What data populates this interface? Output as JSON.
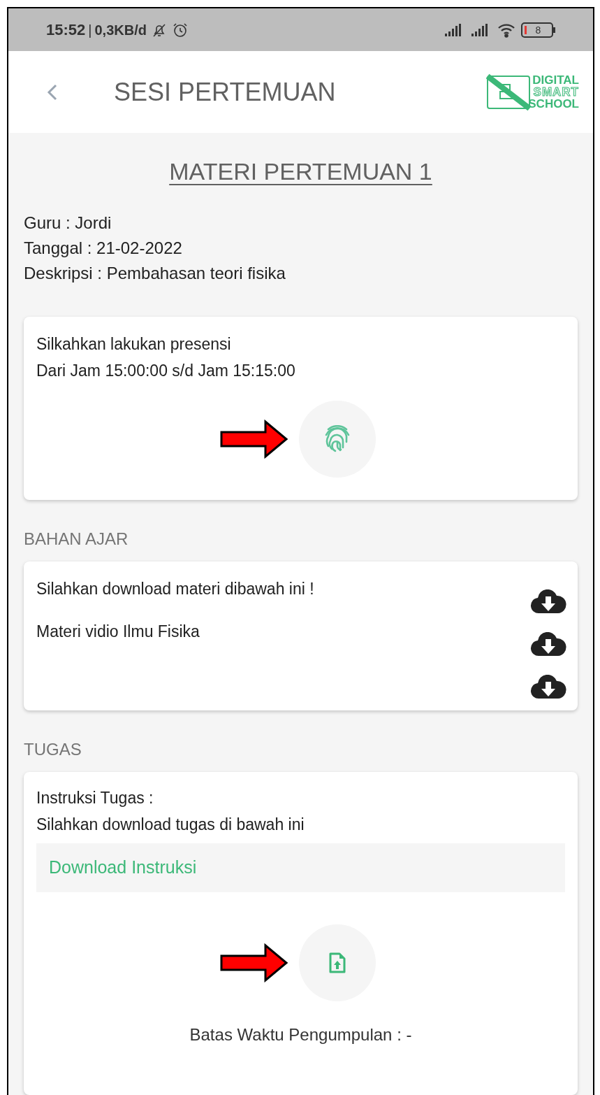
{
  "status_bar": {
    "time": "15:52",
    "separator": "|",
    "data_rate": "0,3KB/d",
    "battery": "8"
  },
  "header": {
    "title": "SESI PERTEMUAN",
    "logo": [
      "DIGITAL",
      "SMART",
      "SCHOOL"
    ]
  },
  "meeting": {
    "title": "MATERI PERTEMUAN 1",
    "info": [
      "Guru : Jordi",
      "Tanggal : 21-02-2022",
      "Deskripsi : Pembahasan teori fisika"
    ]
  },
  "attendance": {
    "lines": [
      "Silkahkan lakukan presensi",
      "Dari Jam 15:00:00 s/d Jam 15:15:00"
    ]
  },
  "materials": {
    "heading": "BAHAN AJAR",
    "items": [
      {
        "kind": "labeled",
        "label": "Silahkan download materi dibawah ini !"
      },
      {
        "kind": "labeled",
        "label": "Materi vidio Ilmu Fisika"
      },
      {
        "kind": "icon_only"
      }
    ]
  },
  "assignment": {
    "heading": "TUGAS",
    "instructions": [
      "Instruksi Tugas :",
      "Silahkan download tugas di bawah ini"
    ],
    "download_link": "Download Instruksi",
    "deadline": "Batas Waktu Pengumpulan : -"
  }
}
